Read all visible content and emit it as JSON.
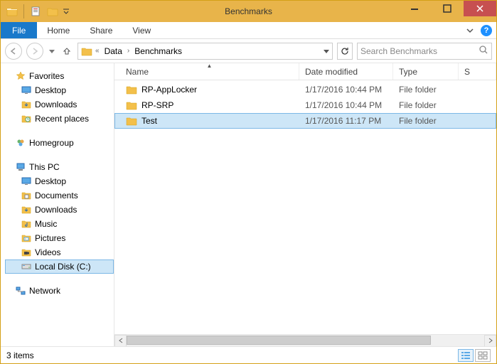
{
  "window": {
    "title": "Benchmarks"
  },
  "ribbon": {
    "file": "File",
    "tabs": [
      "Home",
      "Share",
      "View"
    ]
  },
  "address": {
    "crumbs": [
      "Data",
      "Benchmarks"
    ],
    "refresh_tooltip": "Refresh"
  },
  "search": {
    "placeholder": "Search Benchmarks"
  },
  "columns": {
    "name": "Name",
    "date": "Date modified",
    "type": "Type",
    "size": "S"
  },
  "nav": {
    "favorites": {
      "label": "Favorites",
      "items": [
        "Desktop",
        "Downloads",
        "Recent places"
      ]
    },
    "homegroup": {
      "label": "Homegroup"
    },
    "thispc": {
      "label": "This PC",
      "items": [
        "Desktop",
        "Documents",
        "Downloads",
        "Music",
        "Pictures",
        "Videos",
        "Local Disk (C:)"
      ]
    },
    "network": {
      "label": "Network"
    }
  },
  "files": [
    {
      "name": "RP-AppLocker",
      "date": "1/17/2016 10:44 PM",
      "type": "File folder",
      "selected": false
    },
    {
      "name": "RP-SRP",
      "date": "1/17/2016 10:44 PM",
      "type": "File folder",
      "selected": false
    },
    {
      "name": "Test",
      "date": "1/17/2016 11:17 PM",
      "type": "File folder",
      "selected": true
    }
  ],
  "status": {
    "count": "3 items"
  }
}
